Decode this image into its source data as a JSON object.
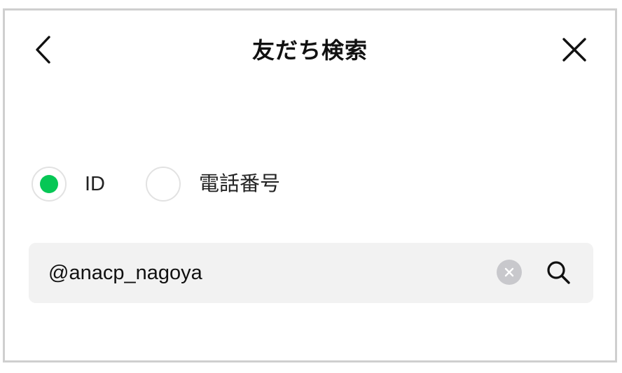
{
  "header": {
    "title": "友だち検索",
    "back_icon": "chevron-left-icon",
    "close_icon": "close-icon"
  },
  "search_type": {
    "options": [
      {
        "label": "ID",
        "selected": true
      },
      {
        "label": "電話番号",
        "selected": false
      }
    ],
    "selected_color": "#06c755"
  },
  "search": {
    "value": "@anacp_nagoya",
    "clear_icon": "clear-icon",
    "search_icon": "search-icon"
  }
}
